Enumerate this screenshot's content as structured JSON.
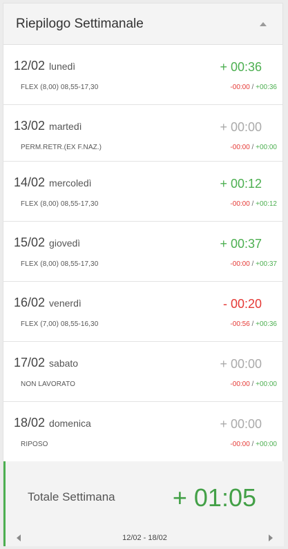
{
  "header": {
    "title": "Riepilogo Settimanale"
  },
  "days": [
    {
      "date": "12/02",
      "weekday": "lunedì",
      "schedule": "FLEX (8,00) 08,55-17,30",
      "balance": "+ 00:36",
      "balance_type": "pos",
      "debit": "-00:00",
      "separator": " / ",
      "credit": "+00:36"
    },
    {
      "date": "13/02",
      "weekday": "martedì",
      "schedule": "PERM.RETR.(EX F.NAZ.)",
      "balance": "+ 00:00",
      "balance_type": "zero",
      "debit": "-00:00",
      "separator": " / ",
      "credit": "+00:00"
    },
    {
      "date": "14/02",
      "weekday": "mercoledì",
      "schedule": "FLEX (8,00) 08,55-17,30",
      "balance": "+ 00:12",
      "balance_type": "pos",
      "debit": "-00:00",
      "separator": " / ",
      "credit": "+00:12"
    },
    {
      "date": "15/02",
      "weekday": "giovedì",
      "schedule": "FLEX (8,00) 08,55-17,30",
      "balance": "+ 00:37",
      "balance_type": "pos",
      "debit": "-00:00",
      "separator": " / ",
      "credit": "+00:37"
    },
    {
      "date": "16/02",
      "weekday": "venerdì",
      "schedule": "FLEX (7,00) 08,55-16,30",
      "balance": "- 00:20",
      "balance_type": "neg",
      "debit": "-00:56",
      "separator": " / ",
      "credit": "+00:36"
    },
    {
      "date": "17/02",
      "weekday": "sabato",
      "schedule": "NON LAVORATO",
      "balance": "+ 00:00",
      "balance_type": "zero",
      "debit": "-00:00",
      "separator": " / ",
      "credit": "+00:00"
    },
    {
      "date": "18/02",
      "weekday": "domenica",
      "schedule": "RIPOSO",
      "balance": "+ 00:00",
      "balance_type": "zero",
      "debit": "-00:00",
      "separator": " / ",
      "credit": "+00:00"
    }
  ],
  "total": {
    "label": "Totale Settimana",
    "value": "+ 01:05"
  },
  "nav": {
    "range": "12/02 - 18/02",
    "prev_icon": "caret-left-icon",
    "next_icon": "caret-right-icon"
  },
  "colors": {
    "positive": "#4caf50",
    "negative": "#e53935",
    "neutral": "#aaaaaa",
    "total_accent": "#43a047"
  }
}
